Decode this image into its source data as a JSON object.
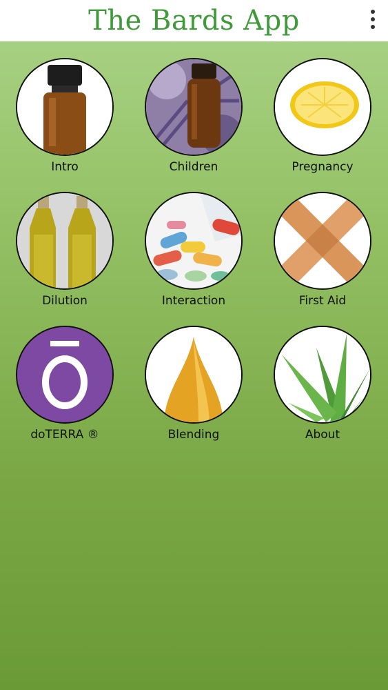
{
  "header": {
    "title": "The Bards App",
    "menu_icon": "overflow-menu-icon"
  },
  "tiles": [
    {
      "label": "Intro",
      "icon": "oil-bottle-icon"
    },
    {
      "label": "Children",
      "icon": "lavender-bottle-icon"
    },
    {
      "label": "Pregnancy",
      "icon": "lemon-icon"
    },
    {
      "label": "Dilution",
      "icon": "oil-bottles-icon"
    },
    {
      "label": "Interaction",
      "icon": "pills-icon"
    },
    {
      "label": "First Aid",
      "icon": "bandage-icon"
    },
    {
      "label": "doTERRA ®",
      "icon": "doterra-logo-icon"
    },
    {
      "label": "Blending",
      "icon": "oil-drop-icon"
    },
    {
      "label": "About",
      "icon": "aloe-icon"
    }
  ],
  "colors": {
    "title_green": "#3f9a3a",
    "background_top": "#abd488",
    "background_bottom": "#6a9a36",
    "doterra_purple": "#7d49a3"
  }
}
